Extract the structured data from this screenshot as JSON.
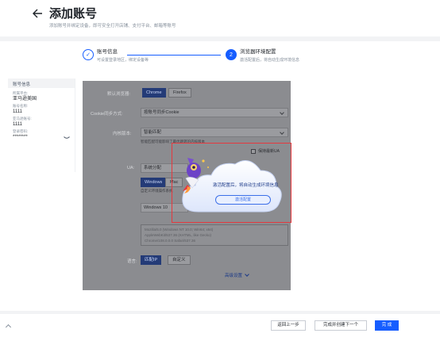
{
  "header": {
    "title": "添加账号",
    "subtitle": "添加账号并绑定设备，即可安全打开店铺、支付平台、邮箱等账号"
  },
  "steps": [
    {
      "number": "✓",
      "title": "账号信息",
      "desc": "可设置登录地区，绑定设备等"
    },
    {
      "number": "2",
      "title": "浏览器环境配置",
      "desc": "激活配置后，将自动生成环境信息"
    }
  ],
  "summary": {
    "heading": "账号信息",
    "platform_label": "所属平台:",
    "platform_value": "亚马逊美国",
    "name_label": "账号名称:",
    "name_value": "1111",
    "amazon_id_label": "亚马逊账号:",
    "amazon_id_value": "1111",
    "password_label": "登录密码:",
    "password_value": "********"
  },
  "form": {
    "browser_label": "默认浏览器:",
    "browser_options": [
      "Chrome",
      "Firefox"
    ],
    "cookie_label": "Cookie同步方式:",
    "cookie_value": "按账号同步Cookie",
    "kernel_label": "内核版本:",
    "kernel_value": "智能匹配",
    "kernel_hint": "智能匹配可能影响了最优跳转的内核版本",
    "keep_ua_label": "保持最新UA",
    "ua_label": "UA:",
    "ua_value": "系统分配",
    "os_options": [
      "Windows",
      "Mac"
    ],
    "os_hint": "自定义环境操作系统",
    "os_version": "Windows 10",
    "ua_lines": [
      "Mozilla/5.0 (Windows NT 10.0; Win64; x64)",
      "AppleWebKit/537.36 (KHTML, like Gecko)",
      "Chrome/108.0.0.0 Safari/537.36"
    ],
    "lang_label": "语言:",
    "lang_options": [
      "匹配IP",
      "自定义"
    ],
    "advanced_link": "高级设置"
  },
  "popup": {
    "message": "激活配置后，将自动生成环境信息",
    "button_label": "激活配置"
  },
  "footer": {
    "back_label": "返回上一步",
    "complete_next_label": "完成并创建下一个",
    "done_label": "完 成"
  },
  "colors": {
    "primary": "#165dff",
    "highlight": "#e5393e",
    "mask": "#8b8c90"
  }
}
